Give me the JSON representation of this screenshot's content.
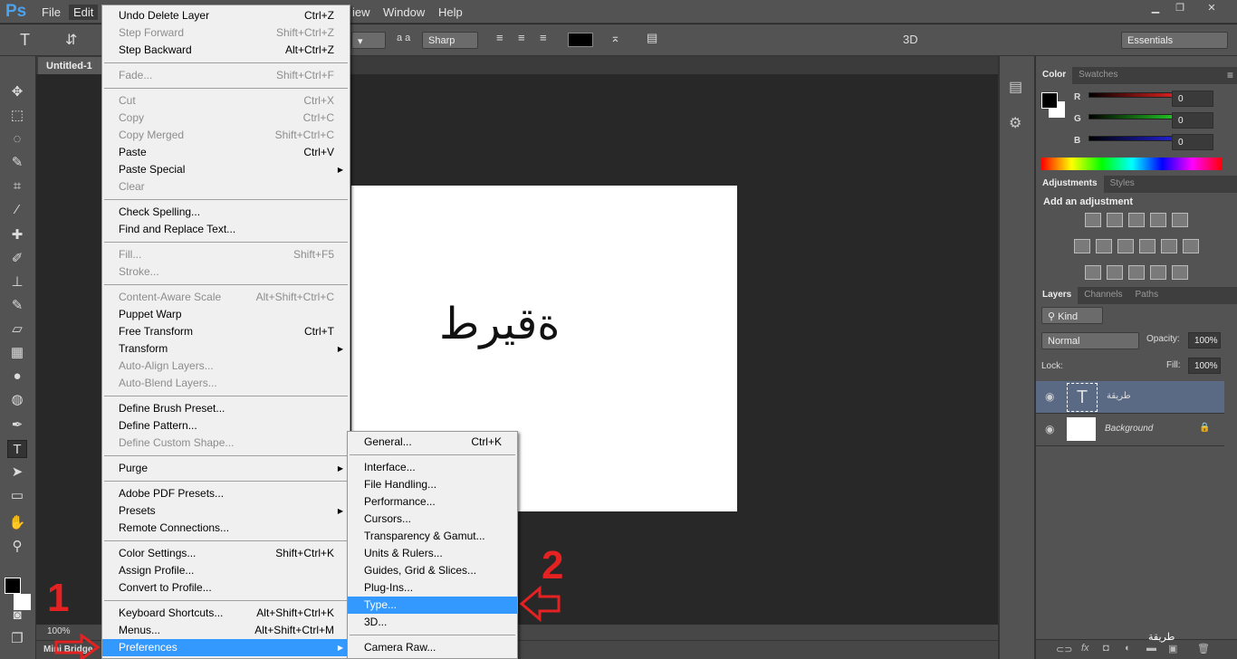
{
  "app": {
    "logo": "Ps"
  },
  "menubar": {
    "items": [
      "File",
      "Edit",
      "View",
      "Window",
      "Help"
    ],
    "view_partial": "iew"
  },
  "options": {
    "antialias": "Sharp",
    "workspace": "Essentials",
    "mode_3d": "3D",
    "aa_label": "a a"
  },
  "document": {
    "tab": "Untitled-1",
    "text": "طريقة",
    "zoom": "100%"
  },
  "bottom": {
    "mini_bridge": "Mini Bridge"
  },
  "edit_menu": [
    {
      "label": "Undo Delete Layer",
      "shortcut": "Ctrl+Z"
    },
    {
      "label": "Step Forward",
      "shortcut": "Shift+Ctrl+Z",
      "disabled": true
    },
    {
      "label": "Step Backward",
      "shortcut": "Alt+Ctrl+Z"
    },
    {
      "sep": true
    },
    {
      "label": "Fade...",
      "shortcut": "Shift+Ctrl+F",
      "disabled": true
    },
    {
      "sep": true
    },
    {
      "label": "Cut",
      "shortcut": "Ctrl+X",
      "disabled": true
    },
    {
      "label": "Copy",
      "shortcut": "Ctrl+C",
      "disabled": true
    },
    {
      "label": "Copy Merged",
      "shortcut": "Shift+Ctrl+C",
      "disabled": true
    },
    {
      "label": "Paste",
      "shortcut": "Ctrl+V"
    },
    {
      "label": "Paste Special",
      "submenu": true
    },
    {
      "label": "Clear",
      "disabled": true
    },
    {
      "sep": true
    },
    {
      "label": "Check Spelling..."
    },
    {
      "label": "Find and Replace Text..."
    },
    {
      "sep": true
    },
    {
      "label": "Fill...",
      "shortcut": "Shift+F5",
      "disabled": true
    },
    {
      "label": "Stroke...",
      "disabled": true
    },
    {
      "sep": true
    },
    {
      "label": "Content-Aware Scale",
      "shortcut": "Alt+Shift+Ctrl+C",
      "disabled": true
    },
    {
      "label": "Puppet Warp"
    },
    {
      "label": "Free Transform",
      "shortcut": "Ctrl+T"
    },
    {
      "label": "Transform",
      "submenu": true
    },
    {
      "label": "Auto-Align Layers...",
      "disabled": true
    },
    {
      "label": "Auto-Blend Layers...",
      "disabled": true
    },
    {
      "sep": true
    },
    {
      "label": "Define Brush Preset..."
    },
    {
      "label": "Define Pattern..."
    },
    {
      "label": "Define Custom Shape...",
      "disabled": true
    },
    {
      "sep": true
    },
    {
      "label": "Purge",
      "submenu": true
    },
    {
      "sep": true
    },
    {
      "label": "Adobe PDF Presets..."
    },
    {
      "label": "Presets",
      "submenu": true
    },
    {
      "label": "Remote Connections..."
    },
    {
      "sep": true
    },
    {
      "label": "Color Settings...",
      "shortcut": "Shift+Ctrl+K"
    },
    {
      "label": "Assign Profile..."
    },
    {
      "label": "Convert to Profile..."
    },
    {
      "sep": true
    },
    {
      "label": "Keyboard Shortcuts...",
      "shortcut": "Alt+Shift+Ctrl+K"
    },
    {
      "label": "Menus...",
      "shortcut": "Alt+Shift+Ctrl+M"
    },
    {
      "label": "Preferences",
      "submenu": true,
      "highlighted": true
    }
  ],
  "preferences_menu": [
    {
      "label": "General...",
      "shortcut": "Ctrl+K"
    },
    {
      "sep": true
    },
    {
      "label": "Interface..."
    },
    {
      "label": "File Handling..."
    },
    {
      "label": "Performance..."
    },
    {
      "label": "Cursors..."
    },
    {
      "label": "Transparency & Gamut..."
    },
    {
      "label": "Units & Rulers..."
    },
    {
      "label": "Guides, Grid & Slices..."
    },
    {
      "label": "Plug-Ins..."
    },
    {
      "label": "Type...",
      "highlighted": true
    },
    {
      "label": "3D..."
    },
    {
      "sep": true
    },
    {
      "label": "Camera Raw..."
    }
  ],
  "annotations": {
    "step1": "1",
    "step2": "2",
    "color": "#e52222"
  },
  "color_panel": {
    "tabs": [
      "Color",
      "Swatches"
    ],
    "channels": [
      {
        "name": "R",
        "value": "0",
        "color": "#d42020"
      },
      {
        "name": "G",
        "value": "0",
        "color": "#22c022"
      },
      {
        "name": "B",
        "value": "0",
        "color": "#2020d0"
      }
    ]
  },
  "adjustments_panel": {
    "tabs": [
      "Adjustments",
      "Styles"
    ],
    "heading": "Add an adjustment"
  },
  "layers_panel": {
    "tabs": [
      "Layers",
      "Channels",
      "Paths"
    ],
    "filter": "Kind",
    "blend_mode": "Normal",
    "opacity_label": "Opacity:",
    "opacity": "100%",
    "lock_label": "Lock:",
    "fill_label": "Fill:",
    "fill": "100%",
    "layers": [
      {
        "name": "طريقة",
        "type": "text",
        "selected": true
      },
      {
        "name": "Background",
        "type": "background",
        "locked": true
      }
    ]
  },
  "watermark": "طريقة"
}
